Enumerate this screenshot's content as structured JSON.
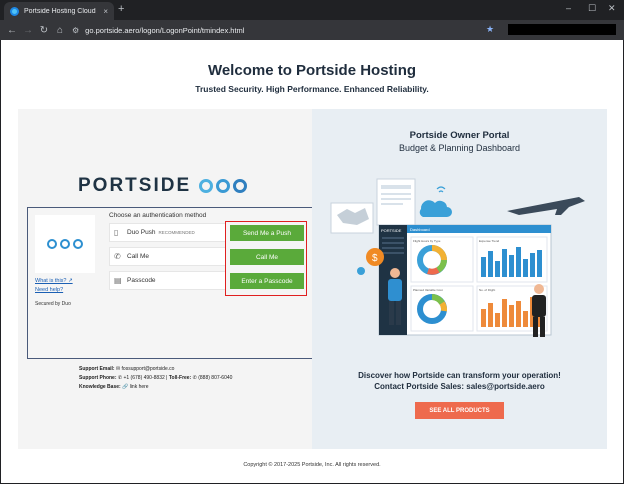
{
  "browser": {
    "tab_title": "Portside Hosting Cloud",
    "tab_close": "×",
    "new_tab": "+",
    "url": "go.portside.aero/logon/LogonPoint/tmindex.html",
    "win_min": "–",
    "win_max": "☐",
    "win_close": "✕"
  },
  "page": {
    "title": "Welcome to Portside Hosting",
    "subtitle": "Trusted Security. High Performance. Enhanced Reliability."
  },
  "logo": {
    "text": "PORTSIDE"
  },
  "duo": {
    "heading": "Choose an authentication method",
    "methods": [
      {
        "label": "Duo Push",
        "tag": "RECOMMENDED",
        "button": "Send Me a Push",
        "icon": "phone-icon"
      },
      {
        "label": "Call Me",
        "tag": "",
        "button": "Call Me",
        "icon": "call-icon"
      },
      {
        "label": "Passcode",
        "tag": "",
        "button": "Enter a Passcode",
        "icon": "passcode-icon"
      }
    ],
    "what_is_this": "What is this? ↗",
    "need_help": "Need help?",
    "secured_by": "Secured by Duo",
    "accent": "#5aaa3a"
  },
  "support": {
    "email_label": "Support Email:",
    "email": "✉ fossupport@portside.co",
    "phone_label": "Support Phone:",
    "phone": "✆ +1 (678) 490-8832",
    "tollfree_label": "Toll-Free:",
    "tollfree": "✆ (888) 807-6040",
    "kb_label": "Knowledge Base:",
    "kb": "🔗 link here"
  },
  "portal": {
    "title": "Portside Owner Portal",
    "subtitle": "Budget & Planning Dashboard",
    "discover": "Discover how Portside can transform your operation!",
    "contact": "Contact Portside Sales: sales@portside.aero",
    "cta": "SEE ALL PRODUCTS",
    "cta_color": "#ee6a4d",
    "dashboard_brand": "PORTSIDE",
    "dashboard_tab": "Dashboard",
    "panel_1": "Flight Hours by Type",
    "panel_2": "Expense Trend",
    "panel_3": "Planned Variable Cost",
    "panel_4": "No. of Flight",
    "dollar_sign": "$"
  },
  "footer": {
    "copyright": "Copyright © 2017-2025 Portside, Inc. All rights reserved."
  }
}
